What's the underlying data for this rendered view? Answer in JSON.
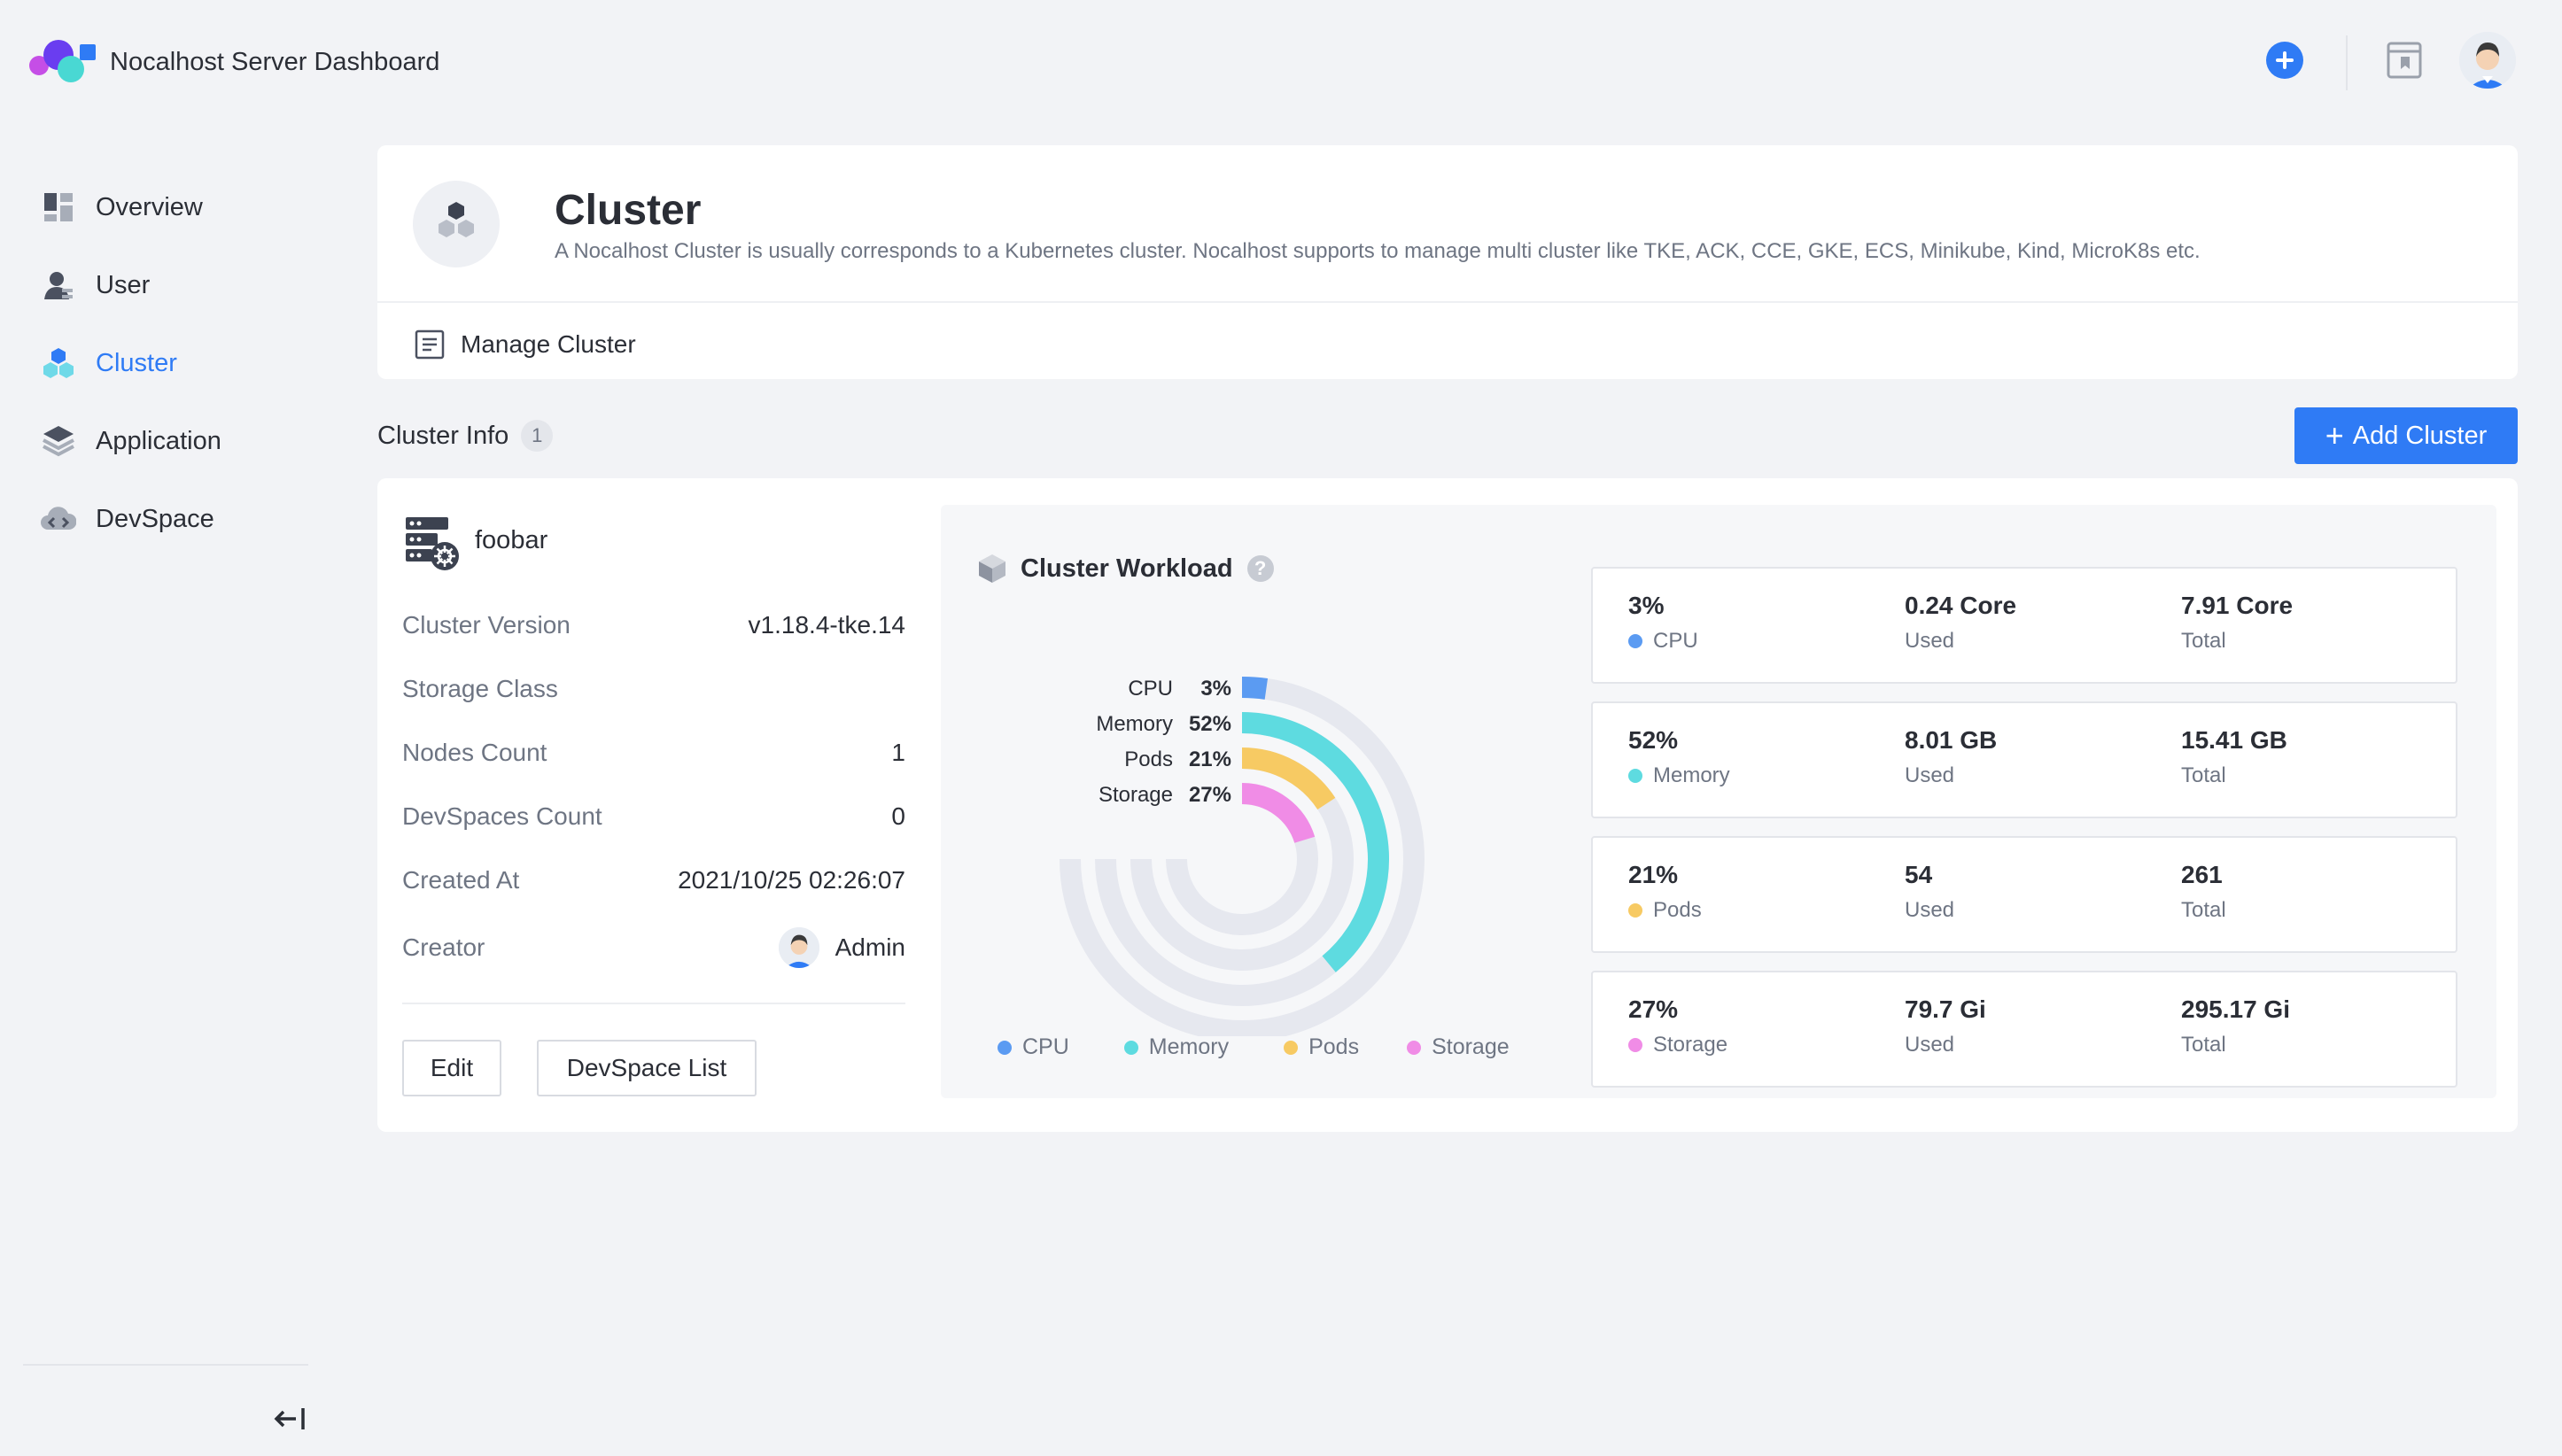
{
  "app": {
    "title": "Nocalhost Server Dashboard"
  },
  "header": {
    "icons": [
      "add-circle-icon",
      "docs-icon",
      "user-avatar"
    ]
  },
  "sidebar": {
    "items": [
      {
        "label": "Overview",
        "icon": "overview-icon"
      },
      {
        "label": "User",
        "icon": "user-icon"
      },
      {
        "label": "Cluster",
        "icon": "cluster-icon",
        "active": true
      },
      {
        "label": "Application",
        "icon": "layers-icon"
      },
      {
        "label": "DevSpace",
        "icon": "cloud-code-icon"
      }
    ],
    "collapse_icon": "collapse-arrow-icon"
  },
  "page": {
    "title": "Cluster",
    "description": "A Nocalhost Cluster is usually corresponds to a Kubernetes cluster. Nocalhost supports to manage multi cluster like TKE, ACK, CCE, GKE, ECS, Minikube, Kind, MicroK8s etc.",
    "manage_label": "Manage Cluster"
  },
  "cluster_info": {
    "title": "Cluster Info",
    "count": "1",
    "add_button": "Add Cluster",
    "add_button_symbol": "+"
  },
  "cluster": {
    "name": "foobar",
    "fields": [
      {
        "key": "Cluster Version",
        "value": "v1.18.4-tke.14"
      },
      {
        "key": "Storage Class",
        "value": ""
      },
      {
        "key": "Nodes Count",
        "value": "1"
      },
      {
        "key": "DevSpaces Count",
        "value": "0"
      },
      {
        "key": "Created At",
        "value": "2021/10/25 02:26:07"
      },
      {
        "key": "Creator",
        "value": "Admin"
      }
    ],
    "edit_button": "Edit",
    "devspace_button": "DevSpace List"
  },
  "workload": {
    "title": "Cluster Workload",
    "help_symbol": "?",
    "colors": {
      "cpu": "#5b9bf2",
      "memory": "#5edbe0",
      "pods": "#f7ca63",
      "storage": "#f08ce6",
      "track": "#e6e8ef"
    },
    "stats": [
      {
        "percent": "3%",
        "name": "CPU",
        "used": "0.24 Core",
        "used_label": "Used",
        "total": "7.91 Core",
        "total_label": "Total",
        "color": "#5b9bf2"
      },
      {
        "percent": "52%",
        "name": "Memory",
        "used": "8.01 GB",
        "used_label": "Used",
        "total": "15.41 GB",
        "total_label": "Total",
        "color": "#5edbe0"
      },
      {
        "percent": "21%",
        "name": "Pods",
        "used": "54",
        "used_label": "Used",
        "total": "261",
        "total_label": "Total",
        "color": "#f7ca63"
      },
      {
        "percent": "27%",
        "name": "Storage",
        "used": "79.7 Gi",
        "used_label": "Used",
        "total": "295.17 Gi",
        "total_label": "Total",
        "color": "#f08ce6"
      }
    ]
  },
  "chart_data": {
    "type": "radial-bar",
    "categories": [
      "CPU",
      "Memory",
      "Pods",
      "Storage"
    ],
    "values": [
      3,
      52,
      21,
      27
    ],
    "value_labels": [
      "3%",
      "52%",
      "21%",
      "27%"
    ],
    "max": 100,
    "legend": [
      "CPU",
      "Memory",
      "Pods",
      "Storage"
    ],
    "legend_position": "bottom"
  }
}
